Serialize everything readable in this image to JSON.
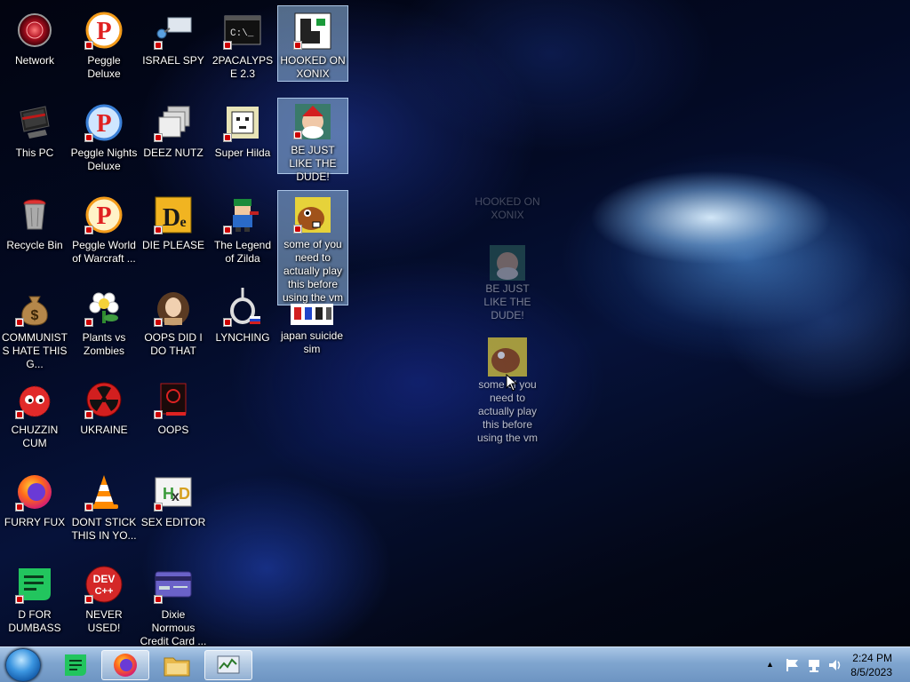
{
  "desktop": {
    "icons": [
      {
        "label": "Network"
      },
      {
        "label": "This PC"
      },
      {
        "label": "Recycle Bin"
      },
      {
        "label": "COMMUNISTS HATE THIS G..."
      },
      {
        "label": "CHUZZIN CUM"
      },
      {
        "label": "FURRY FUX"
      },
      {
        "label": "D FOR DUMBASS"
      },
      {
        "label": "Peggle Deluxe"
      },
      {
        "label": "Peggle Nights Deluxe"
      },
      {
        "label": "Peggle World of Warcraft ..."
      },
      {
        "label": "Plants vs Zombies"
      },
      {
        "label": "UKRAINE"
      },
      {
        "label": "DONT STICK THIS IN YO..."
      },
      {
        "label": "NEVER USED!"
      },
      {
        "label": "ISRAEL SPY"
      },
      {
        "label": "DEEZ NUTZ"
      },
      {
        "label": "DIE PLEASE"
      },
      {
        "label": "OOPS DID I DO THAT"
      },
      {
        "label": "OOPS"
      },
      {
        "label": "SEX EDITOR"
      },
      {
        "label": "Dixie Normous Credit Card ..."
      },
      {
        "label": "2PACALYPSE 2.3"
      },
      {
        "label": "Super Hilda"
      },
      {
        "label": "The Legend of Zilda"
      },
      {
        "label": "LYNCHING"
      },
      {
        "label": "HOOKED ON XONIX"
      },
      {
        "label": "BE JUST LIKE THE DUDE!"
      },
      {
        "label": "some of you need to actually play this before using the vm"
      },
      {
        "label": "japan suicide sim"
      }
    ],
    "drag_ghost": {
      "labels": [
        "HOOKED ON XONIX",
        "BE JUST LIKE THE DUDE!",
        "some of you need to actually play this before using the vm"
      ]
    }
  },
  "taskbar": {
    "pinned": [
      {
        "name": "start-button"
      },
      {
        "name": "notes-app"
      },
      {
        "name": "firefox"
      },
      {
        "name": "file-explorer"
      },
      {
        "name": "task-manager"
      }
    ],
    "clock": {
      "time": "2:24 PM",
      "date": "8/5/2023"
    },
    "tray_chevron": "▲"
  }
}
